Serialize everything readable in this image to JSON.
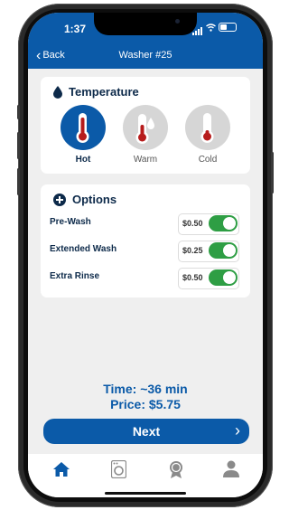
{
  "status_bar": {
    "time": "1:37"
  },
  "nav": {
    "back_label": "Back",
    "title": "Washer #25"
  },
  "temperature": {
    "heading": "Temperature",
    "options": [
      {
        "label": "Hot",
        "selected": true
      },
      {
        "label": "Warm",
        "selected": false
      },
      {
        "label": "Cold",
        "selected": false
      }
    ]
  },
  "options_section": {
    "heading": "Options",
    "items": [
      {
        "label": "Pre-Wash",
        "price": "$0.50",
        "enabled": true
      },
      {
        "label": "Extended Wash",
        "price": "$0.25",
        "enabled": true
      },
      {
        "label": "Extra Rinse",
        "price": "$0.50",
        "enabled": true
      }
    ]
  },
  "summary": {
    "time": "Time: ~36 min",
    "price": "Price: $5.75"
  },
  "next_button": {
    "label": "Next"
  },
  "tabs": [
    {
      "icon": "home-icon",
      "active": true
    },
    {
      "icon": "washer-icon",
      "active": false
    },
    {
      "icon": "rewards-badge-icon",
      "active": false
    },
    {
      "icon": "profile-icon",
      "active": false
    }
  ],
  "colors": {
    "primary": "#0b5aa8",
    "toggle_on": "#2e9e44",
    "thermo_red": "#b71c1c"
  }
}
